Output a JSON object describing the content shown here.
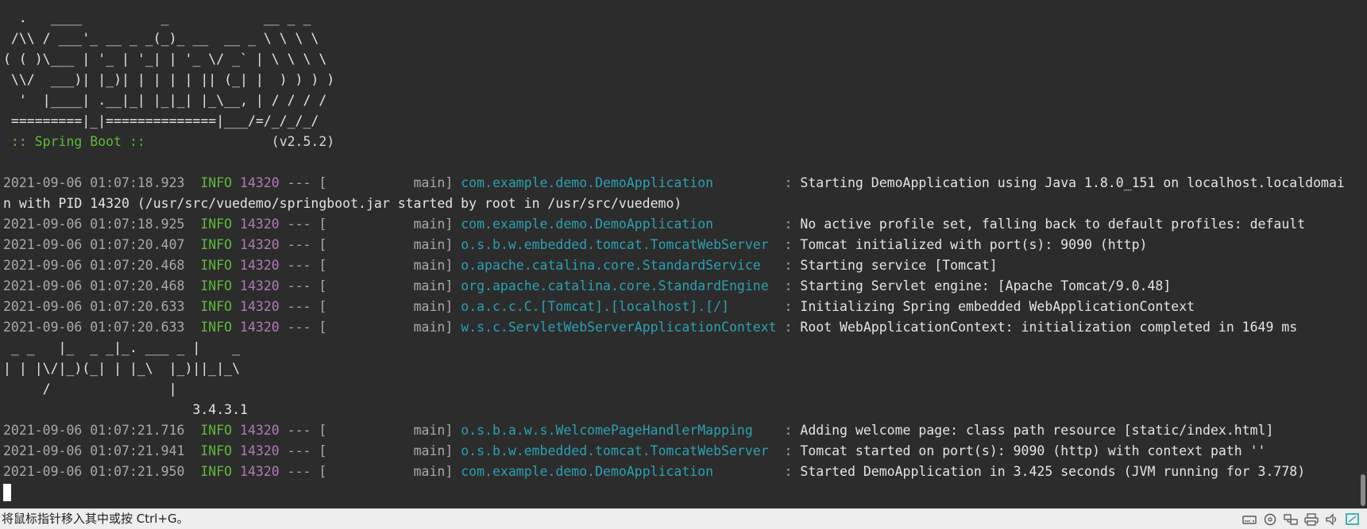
{
  "banner": {
    "lines": [
      "  .   ____          _            __ _ _",
      " /\\\\ / ___'_ __ _ _(_)_ __  __ _ \\ \\ \\ \\",
      "( ( )\\___ | '_ | '_| | '_ \\/ _` | \\ \\ \\ \\",
      " \\\\/  ___)| |_)| | | | | || (_| |  ) ) ) )",
      "  '  |____| .__|_| |_|_| |_\\__, | / / / /",
      " =========|_|==============|___/=/_/_/_/"
    ],
    "spring_label": " :: Spring Boot :: ",
    "spring_version": "               (v2.5.2)"
  },
  "logs_group1": [
    {
      "ts": "2021-09-06 01:07:18.923",
      "level": "INFO",
      "pid": "14320",
      "thread": "main",
      "logger": "com.example.demo.DemoApplication",
      "msg": "Starting DemoApplication using Java 1.8.0_151 on localhost.localdomai",
      "wrap": "n with PID 14320 (/usr/src/vuedemo/springboot.jar started by root in /usr/src/vuedemo)"
    },
    {
      "ts": "2021-09-06 01:07:18.925",
      "level": "INFO",
      "pid": "14320",
      "thread": "main",
      "logger": "com.example.demo.DemoApplication",
      "msg": "No active profile set, falling back to default profiles: default"
    },
    {
      "ts": "2021-09-06 01:07:20.407",
      "level": "INFO",
      "pid": "14320",
      "thread": "main",
      "logger": "o.s.b.w.embedded.tomcat.TomcatWebServer",
      "msg": "Tomcat initialized with port(s): 9090 (http)"
    },
    {
      "ts": "2021-09-06 01:07:20.468",
      "level": "INFO",
      "pid": "14320",
      "thread": "main",
      "logger": "o.apache.catalina.core.StandardService",
      "msg": "Starting service [Tomcat]"
    },
    {
      "ts": "2021-09-06 01:07:20.468",
      "level": "INFO",
      "pid": "14320",
      "thread": "main",
      "logger": "org.apache.catalina.core.StandardEngine",
      "msg": "Starting Servlet engine: [Apache Tomcat/9.0.48]"
    },
    {
      "ts": "2021-09-06 01:07:20.633",
      "level": "INFO",
      "pid": "14320",
      "thread": "main",
      "logger": "o.a.c.c.C.[Tomcat].[localhost].[/]",
      "msg": "Initializing Spring embedded WebApplicationContext"
    },
    {
      "ts": "2021-09-06 01:07:20.633",
      "level": "INFO",
      "pid": "14320",
      "thread": "main",
      "logger": "w.s.c.ServletWebServerApplicationContext",
      "msg": "Root WebApplicationContext: initialization completed in 1649 ms"
    }
  ],
  "banner2": {
    "lines": [
      " _ _   |_  _ _|_. ___ _ |    _",
      "| | |\\/|_)(_| | |_\\  |_)||_|_\\",
      "     /               |"
    ],
    "version": "                        3.4.3.1"
  },
  "logs_group2": [
    {
      "ts": "2021-09-06 01:07:21.716",
      "level": "INFO",
      "pid": "14320",
      "thread": "main",
      "logger": "o.s.b.a.w.s.WelcomePageHandlerMapping",
      "msg": "Adding welcome page: class path resource [static/index.html]"
    },
    {
      "ts": "2021-09-06 01:07:21.941",
      "level": "INFO",
      "pid": "14320",
      "thread": "main",
      "logger": "o.s.b.w.embedded.tomcat.TomcatWebServer",
      "msg": "Tomcat started on port(s): 9090 (http) with context path ''"
    },
    {
      "ts": "2021-09-06 01:07:21.950",
      "level": "INFO",
      "pid": "14320",
      "thread": "main",
      "logger": "com.example.demo.DemoApplication",
      "msg": "Started DemoApplication in 3.425 seconds (JVM running for 3.778)"
    }
  ],
  "status": {
    "hint": "将鼠标指针移入其中或按 Ctrl+G。",
    "icons": [
      "hard-disk-icon",
      "cd-rom-icon",
      "network-icon",
      "printer-icon",
      "sound-icon",
      "message-icon"
    ]
  },
  "colors": {
    "background": "#2c2c2c",
    "info": "#5dbb39",
    "pid": "#b07ab5",
    "logger": "#2aa1b3",
    "text": "#e4e4e4"
  }
}
